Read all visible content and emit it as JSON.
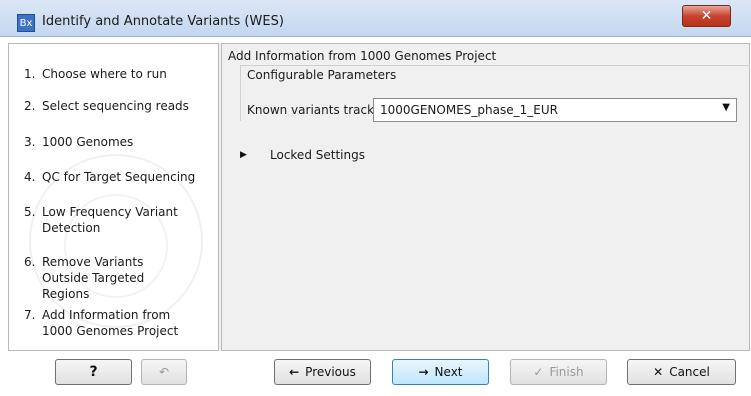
{
  "window": {
    "title": "Identify and Annotate Variants (WES)",
    "app_icon_text": "Bx"
  },
  "steps": [
    {
      "num": "1.",
      "label": "Choose where to run"
    },
    {
      "num": "2.",
      "label": "Select sequencing reads"
    },
    {
      "num": "3.",
      "label": "1000 Genomes"
    },
    {
      "num": "4.",
      "label": "QC for Target Sequencing"
    },
    {
      "num": "5.",
      "label": "Low Frequency Variant Detection"
    },
    {
      "num": "6.",
      "label": "Remove Variants Outside Targeted Regions"
    },
    {
      "num": "7.",
      "label": "Add Information from 1000 Genomes Project"
    }
  ],
  "content": {
    "title": "Add Information from 1000 Genomes Project",
    "group_title": "Configurable Parameters",
    "known_variants_label": "Known variants track",
    "known_variants_value": "1000GENOMES_phase_1_EUR",
    "locked_settings_label": "Locked Settings"
  },
  "buttons": {
    "help": "?",
    "previous": "Previous",
    "next": "Next",
    "finish": "Finish",
    "cancel": "Cancel"
  }
}
